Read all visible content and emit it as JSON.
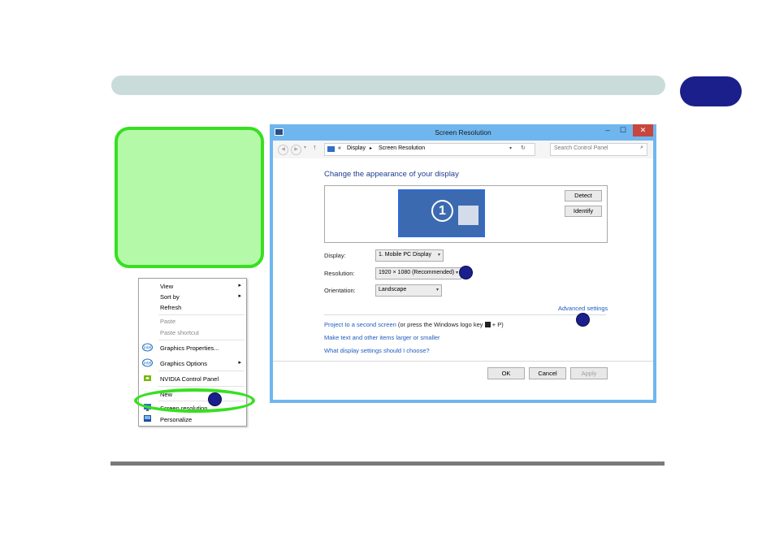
{
  "context_menu": {
    "items": [
      {
        "label": "View",
        "submenu": true,
        "enabled": true,
        "icon": ""
      },
      {
        "label": "Sort by",
        "submenu": true,
        "enabled": true,
        "icon": ""
      },
      {
        "label": "Refresh",
        "submenu": false,
        "enabled": true,
        "icon": ""
      },
      {
        "label": "Paste",
        "submenu": false,
        "enabled": false,
        "icon": ""
      },
      {
        "label": "Paste shortcut",
        "submenu": false,
        "enabled": false,
        "icon": ""
      },
      {
        "label": "Graphics Properties...",
        "submenu": false,
        "enabled": true,
        "icon": "intel-icon"
      },
      {
        "label": "Graphics Options",
        "submenu": true,
        "enabled": true,
        "icon": "intel-icon"
      },
      {
        "label": "NVIDIA Control Panel",
        "submenu": false,
        "enabled": true,
        "icon": "nvidia-icon"
      },
      {
        "label": "New",
        "submenu": true,
        "enabled": true,
        "icon": ""
      },
      {
        "label": "Screen resolution",
        "submenu": false,
        "enabled": true,
        "icon": "display-icon"
      },
      {
        "label": "Personalize",
        "submenu": false,
        "enabled": true,
        "icon": "personalize-icon"
      }
    ]
  },
  "window": {
    "title": "Screen Resolution",
    "address": {
      "separator": "«",
      "crumb_1": "Display",
      "crumb_2": "Screen Resolution"
    },
    "search_placeholder": "Search Control Panel",
    "heading": "Change the appearance of your display",
    "monitor_number": "1",
    "detect_label": "Detect",
    "identify_label": "Identify",
    "display_label": "Display:",
    "display_value": "1. Mobile PC Display",
    "resolution_label": "Resolution:",
    "resolution_value": "1920 × 1080 (Recommended)",
    "orientation_label": "Orientation:",
    "orientation_value": "Landscape",
    "advanced_link": "Advanced settings",
    "project_link": "Project to a second screen",
    "project_suffix": "(or press the Windows logo key",
    "project_keys": "+ P)",
    "text_size_link": "Make text and other items larger or smaller",
    "help_link": "What display settings should I choose?",
    "ok_label": "OK",
    "cancel_label": "Cancel",
    "apply_label": "Apply"
  },
  "colors": {
    "accent_navy": "#1a1f8c",
    "highlight_green": "#36e020",
    "note_fill": "#b4f9a8",
    "window_frame": "#6fb6ef",
    "link": "#1e5cc0"
  }
}
